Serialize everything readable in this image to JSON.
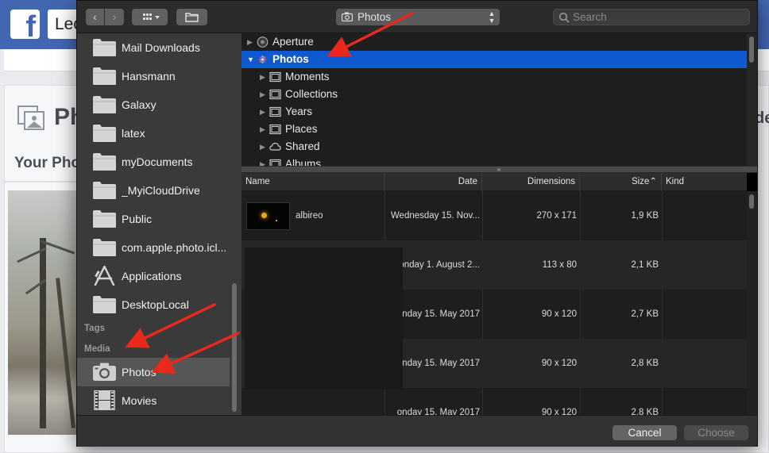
{
  "background": {
    "search_partial": "Leo",
    "photos_title_partial": "Ph",
    "right_partial": "de",
    "your_photos_partial": "Your Pho"
  },
  "toolbar": {
    "back": "‹",
    "forward": "›",
    "view": "▦ ▾",
    "location": "Photos",
    "search_placeholder": "Search"
  },
  "sidebar": {
    "items": [
      {
        "label": "Mail Downloads",
        "icon": "folder-icon"
      },
      {
        "label": "Hansmann",
        "icon": "folder-icon"
      },
      {
        "label": "Galaxy",
        "icon": "folder-icon"
      },
      {
        "label": "latex",
        "icon": "folder-icon"
      },
      {
        "label": "myDocuments",
        "icon": "folder-icon"
      },
      {
        "label": "_MyiCloudDrive",
        "icon": "folder-icon"
      },
      {
        "label": "Public",
        "icon": "folder-icon"
      },
      {
        "label": "com.apple.photo.icl...",
        "icon": "folder-icon"
      },
      {
        "label": "Applications",
        "icon": "applications-icon"
      },
      {
        "label": "DesktopLocal",
        "icon": "folder-icon"
      }
    ],
    "sections": {
      "tags": "Tags",
      "media": "Media"
    },
    "media": [
      {
        "label": "Photos",
        "icon": "camera-icon",
        "selected": true
      },
      {
        "label": "Movies",
        "icon": "film-icon"
      }
    ]
  },
  "browser": {
    "rows": [
      {
        "label": "Aperture",
        "icon": "aperture-icon",
        "expanded": false,
        "level": 0
      },
      {
        "label": "Photos",
        "icon": "photos-app-icon",
        "expanded": true,
        "level": 0,
        "selected": true
      },
      {
        "label": "Moments",
        "icon": "album-icon",
        "level": 1
      },
      {
        "label": "Collections",
        "icon": "album-icon",
        "level": 1
      },
      {
        "label": "Years",
        "icon": "album-icon",
        "level": 1
      },
      {
        "label": "Places",
        "icon": "album-icon",
        "level": 1
      },
      {
        "label": "Shared",
        "icon": "cloud-icon",
        "level": 1
      },
      {
        "label": "Albums",
        "icon": "album-icon",
        "level": 1
      }
    ]
  },
  "list": {
    "columns": {
      "name": "Name",
      "date": "Date",
      "dimensions": "Dimensions",
      "size": "Size",
      "kind": "Kind"
    },
    "rows": [
      {
        "name": "albireo",
        "date": "Wednesday 15. Nov...",
        "dimensions": "270 x 171",
        "size": "1,9 KB"
      },
      {
        "name": "",
        "date": "onday 1. August 2...",
        "dimensions": "113 x 80",
        "size": "2,1 KB"
      },
      {
        "name": "",
        "date": "onday 15. May 2017",
        "dimensions": "90 x 120",
        "size": "2,7 KB"
      },
      {
        "name": "",
        "date": "onday 15. May 2017",
        "dimensions": "90 x 120",
        "size": "2,8 KB"
      },
      {
        "name": "",
        "date": "onday 15. May 2017",
        "dimensions": "90 x 120",
        "size": "2,8 KB"
      }
    ]
  },
  "footer": {
    "cancel": "Cancel",
    "choose": "Choose"
  },
  "colors": {
    "selection": "#0f58d0",
    "annotation_arrow": "#e8291c",
    "facebook_blue": "#4267b2"
  }
}
